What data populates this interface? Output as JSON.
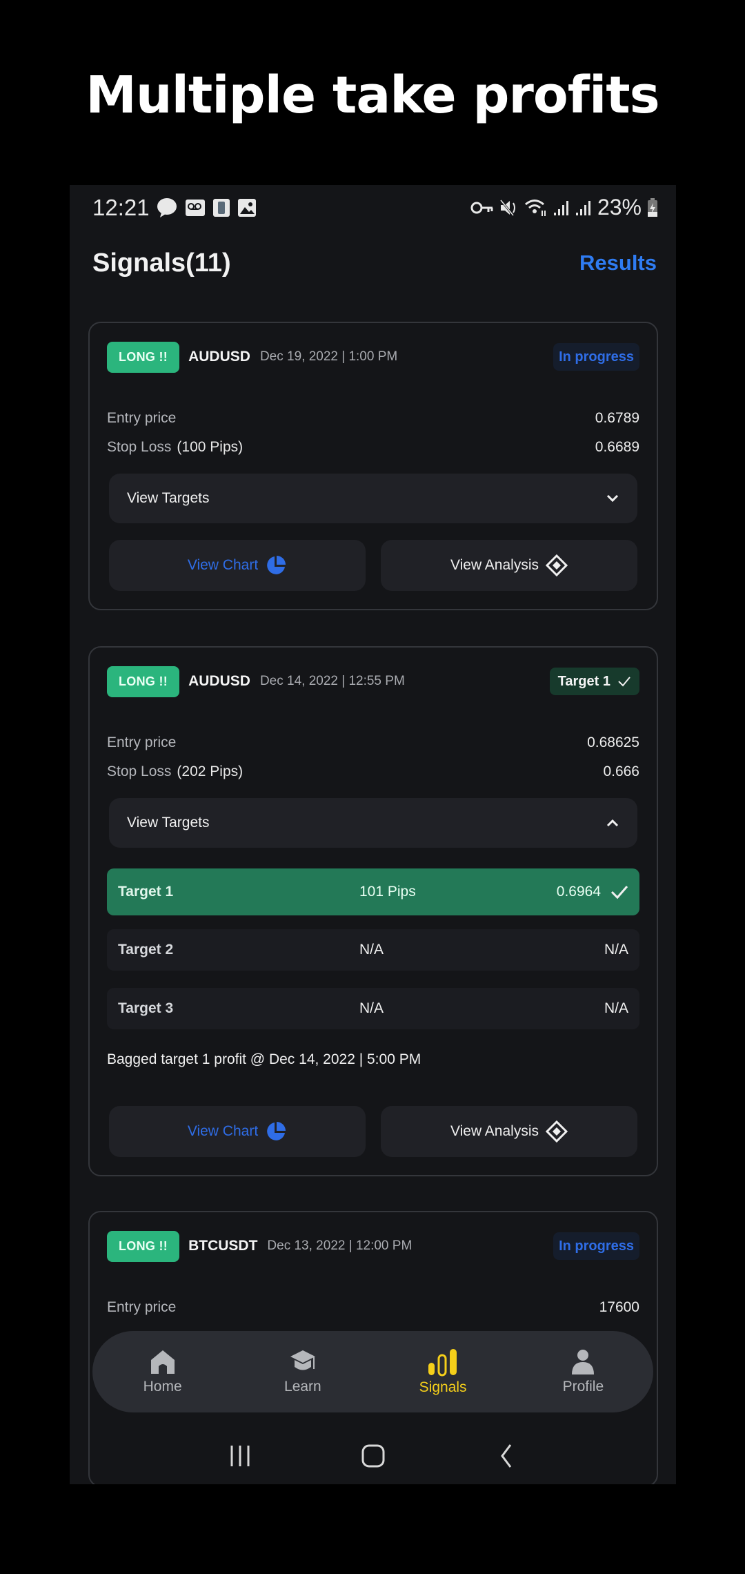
{
  "promo": {
    "title": "Multiple take profits"
  },
  "status_bar": {
    "time": "12:21",
    "left_icons": [
      "message-icon",
      "voicemail-icon",
      "phone-app-icon",
      "gallery-icon"
    ],
    "right_icons": [
      "vpn-key-icon",
      "mute-icon",
      "wifi-icon",
      "signal-icon",
      "signal-icon"
    ],
    "battery": "23%"
  },
  "header": {
    "title": "Signals(11)",
    "results_label": "Results"
  },
  "labels": {
    "entry_price": "Entry price",
    "stop_loss": "Stop Loss",
    "view_targets": "View Targets",
    "view_chart": "View Chart",
    "view_analysis": "View Analysis"
  },
  "signals": [
    {
      "direction": "LONG !!",
      "pair": "AUDUSD",
      "date": "Dec 19, 2022 | 1:00 PM",
      "status": "In progress",
      "entry_price": "0.6789",
      "stop_loss_pips": "(100 Pips)",
      "stop_loss": "0.6689",
      "targets_expanded": false
    },
    {
      "direction": "LONG !!",
      "pair": "AUDUSD",
      "date": "Dec 14, 2022 | 12:55 PM",
      "status": "Target 1",
      "entry_price": "0.68625",
      "stop_loss_pips": "(202 Pips)",
      "stop_loss": "0.666",
      "targets_expanded": true,
      "targets": [
        {
          "name": "Target 1",
          "pips": "101 Pips",
          "price": "0.6964",
          "hit": true
        },
        {
          "name": "Target 2",
          "pips": "N/A",
          "price": "N/A",
          "hit": false
        },
        {
          "name": "Target 3",
          "pips": "N/A",
          "price": "N/A",
          "hit": false
        }
      ],
      "note": "Bagged target 1 profit @ Dec 14, 2022 | 5:00 PM"
    },
    {
      "direction": "LONG !!",
      "pair": "BTCUSDT",
      "date": "Dec 13, 2022 | 12:00 PM",
      "status": "In progress",
      "entry_price": "17600"
    }
  ],
  "bottom_nav": {
    "items": [
      {
        "label": "Home",
        "icon": "home-icon",
        "active": false
      },
      {
        "label": "Learn",
        "icon": "graduation-cap-icon",
        "active": false
      },
      {
        "label": "Signals",
        "icon": "signal-bars-icon",
        "active": true
      },
      {
        "label": "Profile",
        "icon": "profile-icon",
        "active": false
      }
    ]
  },
  "colors": {
    "long_badge": "#2bb57d",
    "accent_blue": "#2f7cf2",
    "target_hit": "#237957",
    "nav_active": "#f5cf1a",
    "background": "#141518"
  }
}
